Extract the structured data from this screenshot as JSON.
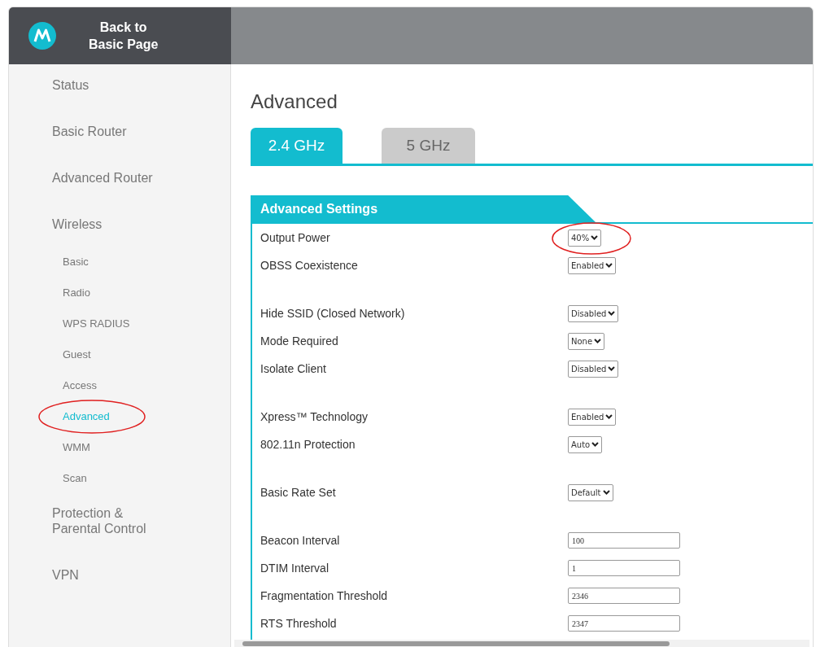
{
  "header": {
    "back_link": "Back to\nBasic Page"
  },
  "sidebar": {
    "items": [
      {
        "label": "Status",
        "selected": false,
        "circled": false
      },
      {
        "label": "Basic Router",
        "selected": false,
        "circled": false
      },
      {
        "label": "Advanced Router",
        "selected": false,
        "circled": false
      },
      {
        "label": "Wireless",
        "selected": false,
        "circled": false,
        "children": [
          {
            "label": "Basic",
            "selected": false,
            "circled": false
          },
          {
            "label": "Radio",
            "selected": false,
            "circled": false
          },
          {
            "label": "WPS RADIUS",
            "selected": false,
            "circled": false
          },
          {
            "label": "Guest",
            "selected": false,
            "circled": false
          },
          {
            "label": "Access",
            "selected": false,
            "circled": false
          },
          {
            "label": "Advanced",
            "selected": true,
            "circled": true
          },
          {
            "label": "WMM",
            "selected": false,
            "circled": false
          },
          {
            "label": "Scan",
            "selected": false,
            "circled": false
          }
        ]
      },
      {
        "label": "Protection &\nParental Control",
        "selected": false,
        "circled": false
      },
      {
        "label": "VPN",
        "selected": false,
        "circled": false
      }
    ]
  },
  "page_title": "Advanced",
  "tabs": [
    {
      "label": "2.4 GHz",
      "selected": true
    },
    {
      "label": "5 GHz",
      "selected": false
    }
  ],
  "section": {
    "title": "Advanced Settings",
    "groups": [
      [
        {
          "label": "Output Power",
          "kind": "select",
          "value": "40%",
          "circled": true
        },
        {
          "label": "OBSS Coexistence",
          "kind": "select",
          "value": "Enabled",
          "circled": false
        }
      ],
      [
        {
          "label": "Hide SSID (Closed Network)",
          "kind": "select",
          "value": "Disabled",
          "circled": false
        },
        {
          "label": "Mode Required",
          "kind": "select",
          "value": "None",
          "circled": false
        },
        {
          "label": "Isolate Client",
          "kind": "select",
          "value": "Disabled",
          "circled": false
        }
      ],
      [
        {
          "label": "Xpress™ Technology",
          "kind": "select",
          "value": "Enabled",
          "circled": false
        },
        {
          "label": "802.11n Protection",
          "kind": "select",
          "value": "Auto",
          "circled": false
        }
      ],
      [
        {
          "label": "Basic Rate Set",
          "kind": "select",
          "value": "Default",
          "circled": false
        }
      ],
      [
        {
          "label": "Beacon Interval",
          "kind": "text",
          "value": "100",
          "circled": false
        },
        {
          "label": "DTIM Interval",
          "kind": "text",
          "value": "1",
          "circled": false
        },
        {
          "label": "Fragmentation Threshold",
          "kind": "text",
          "value": "2346",
          "circled": false
        },
        {
          "label": "RTS Threshold",
          "kind": "text",
          "value": "2347",
          "circled": false
        }
      ]
    ]
  }
}
